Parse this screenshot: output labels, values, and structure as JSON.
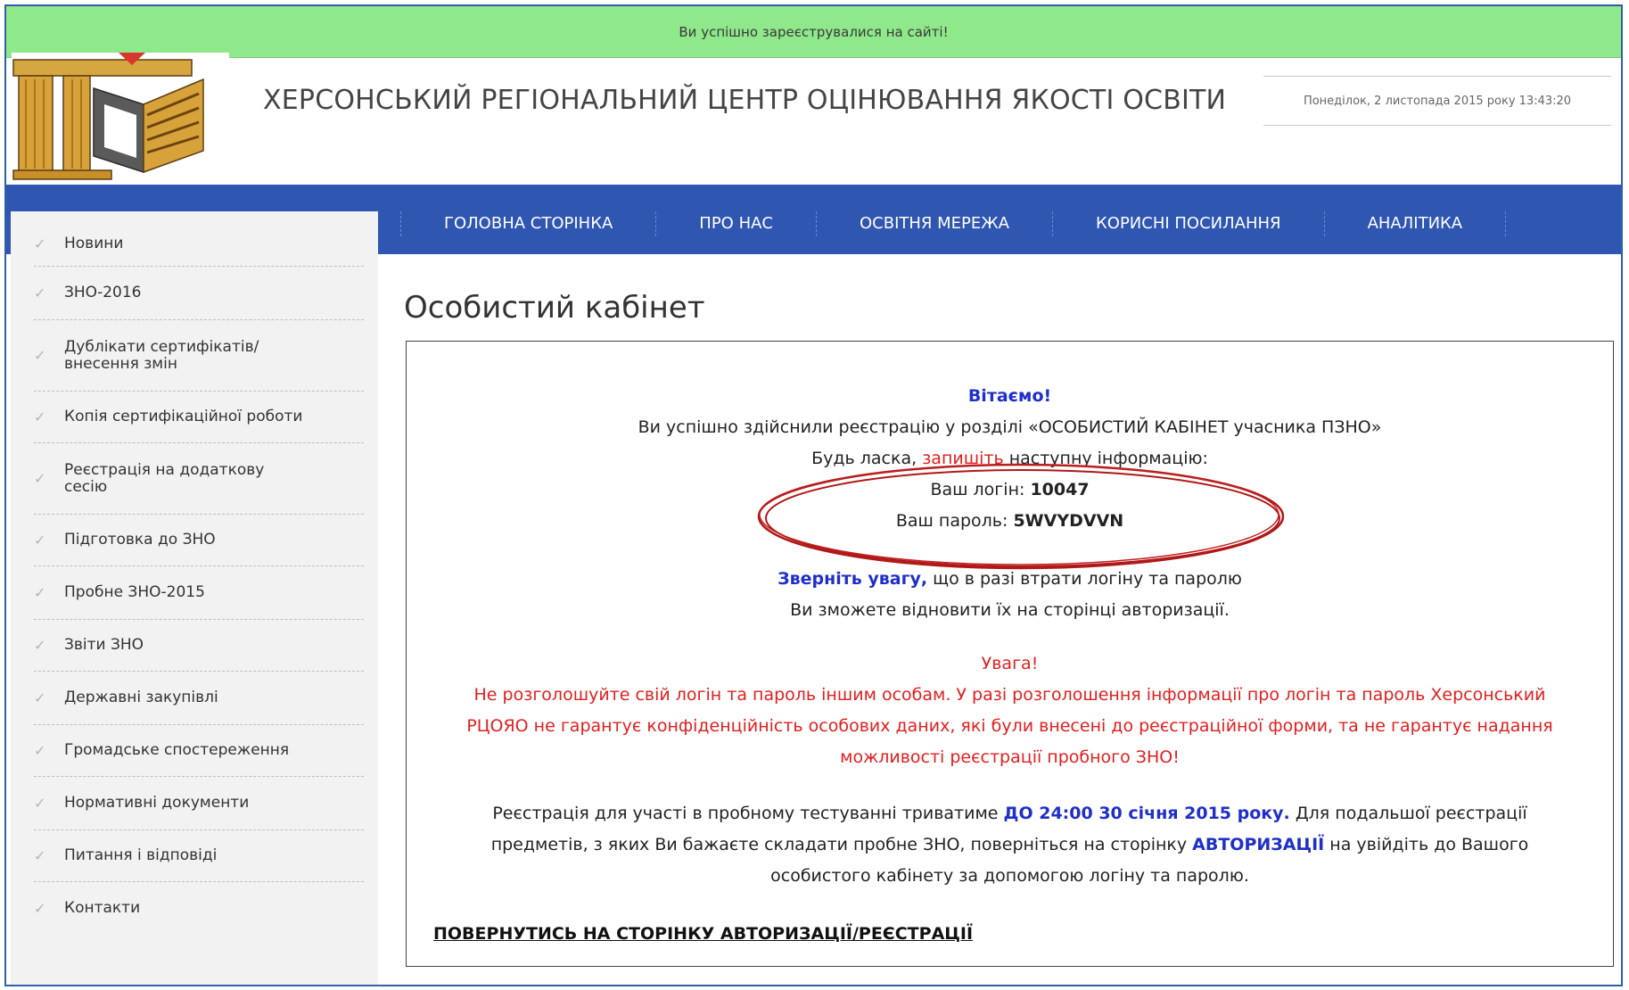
{
  "success_message": "Ви успішно зареєструвалися на сайті!",
  "header": {
    "title": "ХЕРСОНСЬКИЙ РЕГІОНАЛЬНИЙ ЦЕНТР ОЦІНЮВАННЯ ЯКОСТІ ОСВІТИ",
    "date": "Понеділок, 2 листопада 2015 року 13:43:20"
  },
  "nav": {
    "items": [
      "ГОЛОВНА СТОРІНКА",
      "ПРО НАС",
      "ОСВІТНЯ МЕРЕЖА",
      "КОРИСНІ ПОСИЛАННЯ",
      "АНАЛІТИКА"
    ]
  },
  "sidebar": {
    "items": [
      {
        "label": "Новини"
      },
      {
        "label": "ЗНО-2016"
      },
      {
        "label": "Дублікати сертифікатів/ внесення змін"
      },
      {
        "label": "Копія сертифікаційної роботи"
      },
      {
        "label": "Реєстрація на додаткову сесію"
      },
      {
        "label": "Підготовка до ЗНО"
      },
      {
        "label": "Пробне ЗНО-2015"
      },
      {
        "label": "Звіти ЗНО"
      },
      {
        "label": "Державні закупівлі"
      },
      {
        "label": "Громадське спостереження"
      },
      {
        "label": "Нормативні документи"
      },
      {
        "label": "Питання і відповіді"
      },
      {
        "label": "Контакти"
      }
    ]
  },
  "main": {
    "page_title": "Особистий кабінет",
    "greeting": "Вітаємо!",
    "registered": "Ви успішно здійснили реєстрацію у розділі «ОСОБИСТИЙ КАБІНЕТ учасника ПЗНО»",
    "note_prefix": "Будь ласка, ",
    "note_red": "запишіть",
    "note_suffix": " наступну інформацію:",
    "login_label": "Ваш логін: ",
    "login_value": "10047",
    "password_label": "Ваш пароль: ",
    "password_value": "5WVYDVVN",
    "attention_bold": "Зверніть увагу,",
    "attention_rest": " що в разі втрати логіну та паролю",
    "restore": "Ви зможете відновити їх на сторінці авторизації.",
    "warning_title": "Увага!",
    "warning_l1": "Не розголошуйте свій логін та пароль іншим особам. У разі розголошення інформації про логін та пароль Херсонський",
    "warning_l2": "РЦОЯО не гарантує конфіденційність особових даних, які були внесені до реєстраційної форми, та не гарантує надання",
    "warning_l3": "можливості реєстрації пробного ЗНО!",
    "reg_l1_a": "Реєстрація для участі в пробному тестуванні триватиме ",
    "reg_l1_b": "ДО 24:00 30 січня 2015 року.",
    "reg_l1_c": " Для подальшої реєстрації",
    "reg_l2_a": "предметів, з яких Ви бажаєте складати пробне ЗНО, поверніться на сторінку ",
    "reg_l2_b": "АВТОРИЗАЦІЇ",
    "reg_l2_c": " на увійдіть до Вашого",
    "reg_l3": "особистого кабінету за допомогою логіну та паролю.",
    "return_link": "ПОВЕРНУТИСЬ НА СТОРІНКУ АВТОРИЗАЦІЇ/РЕЄСТРАЦІЇ"
  }
}
